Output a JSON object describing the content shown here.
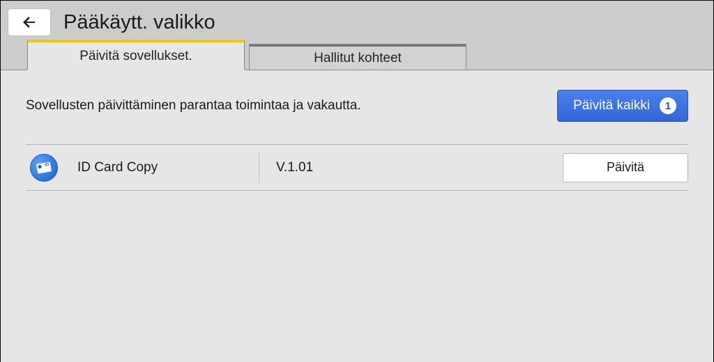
{
  "header": {
    "title": "Pääkäytt. valikko"
  },
  "tabs": {
    "update_apps": "Päivitä sovellukset.",
    "managed_items": "Hallitut kohteet"
  },
  "panel": {
    "description": "Sovellusten päivittäminen parantaa toimintaa ja vakautta.",
    "update_all_label": "Päivitä kaikki",
    "update_all_count": "1"
  },
  "apps": [
    {
      "name": "ID Card Copy",
      "version": "V.1.01",
      "action_label": "Päivitä"
    }
  ]
}
